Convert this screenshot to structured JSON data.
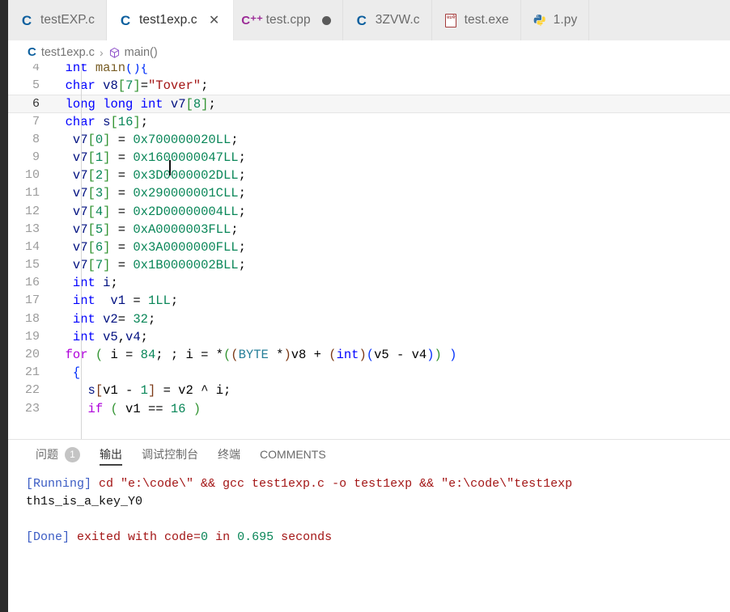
{
  "window": {
    "app": "Visual Studio Code",
    "active_file": "test1exp.c"
  },
  "tabs": [
    {
      "label": "testEXP.c",
      "icon": "c-file-icon",
      "icon_glyph": "C",
      "active": false,
      "dirty": false,
      "closable": false
    },
    {
      "label": "test1exp.c",
      "icon": "c-file-icon",
      "icon_glyph": "C",
      "active": true,
      "dirty": false,
      "closable": true,
      "close_glyph": "✕"
    },
    {
      "label": "test.cpp",
      "icon": "cpp-file-icon",
      "icon_glyph": "C⁺⁺",
      "active": false,
      "dirty": true,
      "closable": false
    },
    {
      "label": "3ZVW.c",
      "icon": "c-file-icon",
      "icon_glyph": "C",
      "active": false,
      "dirty": false,
      "closable": false
    },
    {
      "label": "test.exe",
      "icon": "binary-file-icon",
      "icon_glyph": "",
      "active": false,
      "dirty": false,
      "closable": false
    },
    {
      "label": "1.py",
      "icon": "python-file-icon",
      "icon_glyph": "",
      "active": false,
      "dirty": false,
      "closable": false
    }
  ],
  "breadcrumb": {
    "separator": "›",
    "items": [
      {
        "label": "test1exp.c",
        "icon": "c-file-icon"
      },
      {
        "label": "main()",
        "icon": "symbol-method-icon"
      }
    ]
  },
  "editor": {
    "language": "c",
    "cursor_line": 6,
    "first_visible_line": 4,
    "lines": [
      {
        "n": 4,
        "partial_top": true,
        "tokens": [
          {
            "t": "  ",
            "c": "plain"
          },
          {
            "t": "int",
            "c": "key"
          },
          {
            "t": " ",
            "c": "plain"
          },
          {
            "t": "main",
            "c": "fn"
          },
          {
            "t": "(",
            "c": "brk1"
          },
          {
            "t": ")",
            "c": "brk1"
          },
          {
            "t": "{",
            "c": "brk1"
          }
        ]
      },
      {
        "n": 5,
        "tokens": [
          {
            "t": "  ",
            "c": "plain"
          },
          {
            "t": "char",
            "c": "key"
          },
          {
            "t": " ",
            "c": "plain"
          },
          {
            "t": "v8",
            "c": "id"
          },
          {
            "t": "[",
            "c": "brk2"
          },
          {
            "t": "7",
            "c": "num"
          },
          {
            "t": "]",
            "c": "brk2"
          },
          {
            "t": "=",
            "c": "plain"
          },
          {
            "t": "\"Tover\"",
            "c": "str"
          },
          {
            "t": ";",
            "c": "plain"
          }
        ]
      },
      {
        "n": 6,
        "current": true,
        "tokens": [
          {
            "t": "  ",
            "c": "plain"
          },
          {
            "t": "long",
            "c": "key"
          },
          {
            "t": " ",
            "c": "plain"
          },
          {
            "t": "long",
            "c": "key"
          },
          {
            "t": " ",
            "c": "plain"
          },
          {
            "t": "int",
            "c": "key"
          },
          {
            "t": " ",
            "c": "plain"
          },
          {
            "t": "v7",
            "c": "id"
          },
          {
            "t": "[",
            "c": "brk2"
          },
          {
            "t": "8",
            "c": "num"
          },
          {
            "t": "]",
            "c": "brk2"
          },
          {
            "t": ";",
            "c": "plain"
          }
        ]
      },
      {
        "n": 7,
        "tokens": [
          {
            "t": "  ",
            "c": "plain"
          },
          {
            "t": "char",
            "c": "key"
          },
          {
            "t": " ",
            "c": "plain"
          },
          {
            "t": "s",
            "c": "id"
          },
          {
            "t": "[",
            "c": "brk2"
          },
          {
            "t": "16",
            "c": "num"
          },
          {
            "t": "]",
            "c": "brk2"
          },
          {
            "t": ";",
            "c": "plain"
          }
        ]
      },
      {
        "n": 8,
        "tokens": [
          {
            "t": "   ",
            "c": "plain"
          },
          {
            "t": "v7",
            "c": "id"
          },
          {
            "t": "[",
            "c": "brk2"
          },
          {
            "t": "0",
            "c": "num"
          },
          {
            "t": "]",
            "c": "brk2"
          },
          {
            "t": " = ",
            "c": "plain"
          },
          {
            "t": "0x700000020LL",
            "c": "num"
          },
          {
            "t": ";",
            "c": "plain"
          }
        ]
      },
      {
        "n": 9,
        "tokens": [
          {
            "t": "   ",
            "c": "plain"
          },
          {
            "t": "v7",
            "c": "id"
          },
          {
            "t": "[",
            "c": "brk2"
          },
          {
            "t": "1",
            "c": "num"
          },
          {
            "t": "]",
            "c": "brk2"
          },
          {
            "t": " = ",
            "c": "plain"
          },
          {
            "t": "0x1600000047LL",
            "c": "num"
          },
          {
            "t": ";",
            "c": "plain"
          }
        ]
      },
      {
        "n": 10,
        "tokens": [
          {
            "t": "   ",
            "c": "plain"
          },
          {
            "t": "v7",
            "c": "id"
          },
          {
            "t": "[",
            "c": "brk2"
          },
          {
            "t": "2",
            "c": "num"
          },
          {
            "t": "]",
            "c": "brk2"
          },
          {
            "t": " = ",
            "c": "plain"
          },
          {
            "t": "0x3D0000002DLL",
            "c": "num"
          },
          {
            "t": ";",
            "c": "plain"
          }
        ]
      },
      {
        "n": 11,
        "tokens": [
          {
            "t": "   ",
            "c": "plain"
          },
          {
            "t": "v7",
            "c": "id"
          },
          {
            "t": "[",
            "c": "brk2"
          },
          {
            "t": "3",
            "c": "num"
          },
          {
            "t": "]",
            "c": "brk2"
          },
          {
            "t": " = ",
            "c": "plain"
          },
          {
            "t": "0x290000001CLL",
            "c": "num"
          },
          {
            "t": ";",
            "c": "plain"
          }
        ]
      },
      {
        "n": 12,
        "tokens": [
          {
            "t": "   ",
            "c": "plain"
          },
          {
            "t": "v7",
            "c": "id"
          },
          {
            "t": "[",
            "c": "brk2"
          },
          {
            "t": "4",
            "c": "num"
          },
          {
            "t": "]",
            "c": "brk2"
          },
          {
            "t": " = ",
            "c": "plain"
          },
          {
            "t": "0x2D00000004LL",
            "c": "num"
          },
          {
            "t": ";",
            "c": "plain"
          }
        ]
      },
      {
        "n": 13,
        "tokens": [
          {
            "t": "   ",
            "c": "plain"
          },
          {
            "t": "v7",
            "c": "id"
          },
          {
            "t": "[",
            "c": "brk2"
          },
          {
            "t": "5",
            "c": "num"
          },
          {
            "t": "]",
            "c": "brk2"
          },
          {
            "t": " = ",
            "c": "plain"
          },
          {
            "t": "0xA0000003FLL",
            "c": "num"
          },
          {
            "t": ";",
            "c": "plain"
          }
        ]
      },
      {
        "n": 14,
        "tokens": [
          {
            "t": "   ",
            "c": "plain"
          },
          {
            "t": "v7",
            "c": "id"
          },
          {
            "t": "[",
            "c": "brk2"
          },
          {
            "t": "6",
            "c": "num"
          },
          {
            "t": "]",
            "c": "brk2"
          },
          {
            "t": " = ",
            "c": "plain"
          },
          {
            "t": "0x3A0000000FLL",
            "c": "num"
          },
          {
            "t": ";",
            "c": "plain"
          }
        ]
      },
      {
        "n": 15,
        "tokens": [
          {
            "t": "   ",
            "c": "plain"
          },
          {
            "t": "v7",
            "c": "id"
          },
          {
            "t": "[",
            "c": "brk2"
          },
          {
            "t": "7",
            "c": "num"
          },
          {
            "t": "]",
            "c": "brk2"
          },
          {
            "t": " = ",
            "c": "plain"
          },
          {
            "t": "0x1B0000002BLL",
            "c": "num"
          },
          {
            "t": ";",
            "c": "plain"
          }
        ]
      },
      {
        "n": 16,
        "tokens": [
          {
            "t": "   ",
            "c": "plain"
          },
          {
            "t": "int",
            "c": "key"
          },
          {
            "t": " ",
            "c": "plain"
          },
          {
            "t": "i",
            "c": "id"
          },
          {
            "t": ";",
            "c": "plain"
          }
        ]
      },
      {
        "n": 17,
        "tokens": [
          {
            "t": "   ",
            "c": "plain"
          },
          {
            "t": "int",
            "c": "key"
          },
          {
            "t": "  ",
            "c": "plain"
          },
          {
            "t": "v1",
            "c": "id"
          },
          {
            "t": " = ",
            "c": "plain"
          },
          {
            "t": "1LL",
            "c": "num"
          },
          {
            "t": ";",
            "c": "plain"
          }
        ]
      },
      {
        "n": 18,
        "tokens": [
          {
            "t": "   ",
            "c": "plain"
          },
          {
            "t": "int",
            "c": "key"
          },
          {
            "t": " ",
            "c": "plain"
          },
          {
            "t": "v2",
            "c": "id"
          },
          {
            "t": "= ",
            "c": "plain"
          },
          {
            "t": "32",
            "c": "num"
          },
          {
            "t": ";",
            "c": "plain"
          }
        ]
      },
      {
        "n": 19,
        "tokens": [
          {
            "t": "   ",
            "c": "plain"
          },
          {
            "t": "int",
            "c": "key"
          },
          {
            "t": " ",
            "c": "plain"
          },
          {
            "t": "v5",
            "c": "id"
          },
          {
            "t": ",",
            "c": "plain"
          },
          {
            "t": "v4",
            "c": "id"
          },
          {
            "t": ";",
            "c": "plain"
          }
        ]
      },
      {
        "n": 20,
        "tokens": [
          {
            "t": "  ",
            "c": "plain"
          },
          {
            "t": "for",
            "c": "ctrl"
          },
          {
            "t": " ",
            "c": "plain"
          },
          {
            "t": "(",
            "c": "brk2"
          },
          {
            "t": " i = ",
            "c": "plain"
          },
          {
            "t": "84",
            "c": "num"
          },
          {
            "t": "; ; i = *",
            "c": "plain"
          },
          {
            "t": "(",
            "c": "brk2"
          },
          {
            "t": "(",
            "c": "brk3"
          },
          {
            "t": "BYTE",
            "c": "type"
          },
          {
            "t": " *",
            "c": "plain"
          },
          {
            "t": ")",
            "c": "brk3"
          },
          {
            "t": "v8 + ",
            "c": "plain"
          },
          {
            "t": "(",
            "c": "brk3"
          },
          {
            "t": "int",
            "c": "key"
          },
          {
            "t": ")",
            "c": "brk3"
          },
          {
            "t": "(",
            "c": "brk1"
          },
          {
            "t": "v5 - v4",
            "c": "plain"
          },
          {
            "t": ")",
            "c": "brk1"
          },
          {
            "t": ")",
            "c": "brk2"
          },
          {
            "t": " )",
            "c": "brk1"
          }
        ]
      },
      {
        "n": 21,
        "tokens": [
          {
            "t": "   ",
            "c": "plain"
          },
          {
            "t": "{",
            "c": "brk1"
          }
        ]
      },
      {
        "n": 22,
        "tokens": [
          {
            "t": "     ",
            "c": "plain"
          },
          {
            "t": "s",
            "c": "id"
          },
          {
            "t": "[",
            "c": "brk3"
          },
          {
            "t": "v1 - ",
            "c": "plain"
          },
          {
            "t": "1",
            "c": "num"
          },
          {
            "t": "]",
            "c": "brk3"
          },
          {
            "t": " = v2 ^ i;",
            "c": "plain"
          }
        ]
      },
      {
        "n": 23,
        "partial_bottom": true,
        "tokens": [
          {
            "t": "     ",
            "c": "plain"
          },
          {
            "t": "if",
            "c": "ctrl"
          },
          {
            "t": " ",
            "c": "plain"
          },
          {
            "t": "(",
            "c": "brk2"
          },
          {
            "t": " v1 == ",
            "c": "plain"
          },
          {
            "t": "16",
            "c": "num"
          },
          {
            "t": " ",
            "c": "plain"
          },
          {
            "t": ")",
            "c": "brk2"
          }
        ]
      }
    ]
  },
  "panel": {
    "tabs": [
      {
        "label": "问题",
        "active": false,
        "badge": "1"
      },
      {
        "label": "输出",
        "active": true,
        "badge": null
      },
      {
        "label": "调试控制台",
        "active": false,
        "badge": null
      },
      {
        "label": "终端",
        "active": false,
        "badge": null
      },
      {
        "label": "COMMENTS",
        "active": false,
        "badge": null
      }
    ],
    "output": [
      {
        "name": "running-line",
        "segments": [
          {
            "text": "[Running]",
            "c": "tag-run"
          },
          {
            "text": " cd \"e:\\code\\\" && gcc test1exp.c -o test1exp && \"e:\\code\\\"test1exp",
            "c": "cmd"
          }
        ]
      },
      {
        "name": "program-stdout-line",
        "segments": [
          {
            "text": "th1s_is_a_key_Y0",
            "c": "plain"
          }
        ]
      },
      {
        "name": "blank-line",
        "segments": [
          {
            "text": " ",
            "c": "plain"
          }
        ]
      },
      {
        "name": "done-line",
        "segments": [
          {
            "text": "[Done]",
            "c": "tag-done"
          },
          {
            "text": " exited with code=",
            "c": "cmd"
          },
          {
            "text": "0",
            "c": "num"
          },
          {
            "text": " in ",
            "c": "cmd"
          },
          {
            "text": "0.695",
            "c": "num"
          },
          {
            "text": " seconds",
            "c": "cmd"
          }
        ]
      }
    ]
  },
  "colors": {
    "activity_bar": "#2c2c2c",
    "tab_inactive_bg": "#ececec",
    "tab_active_bg": "#ffffff",
    "accent_c_icon": "#0b5f9e",
    "accent_cpp_icon": "#9b2a96",
    "keyword": "#0000ff",
    "number": "#098658",
    "string": "#a31515",
    "control": "#af00db",
    "identifier": "#001080",
    "type": "#267f99",
    "output_tag": "#3b5cc4",
    "output_cmd": "#a31515",
    "badge_bg": "#c4c4c4"
  }
}
